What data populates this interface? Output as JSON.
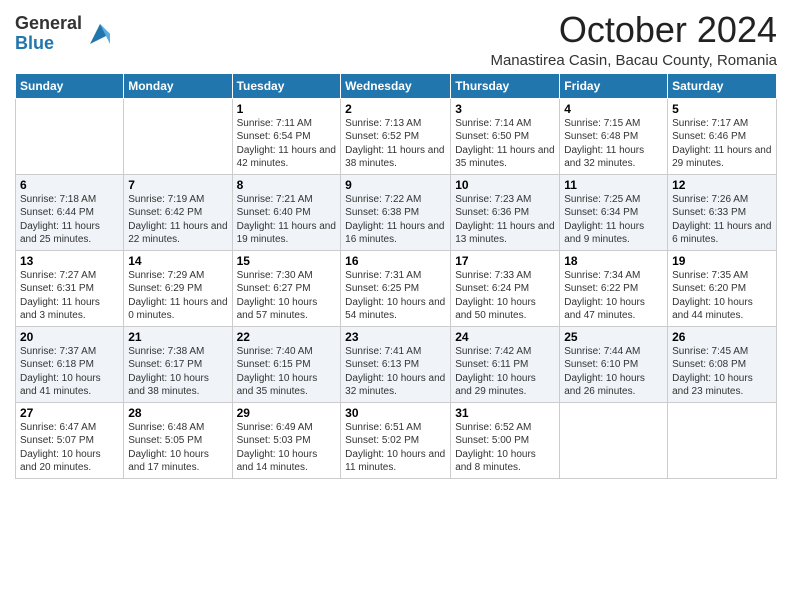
{
  "logo": {
    "general": "General",
    "blue": "Blue"
  },
  "title": "October 2024",
  "location": "Manastirea Casin, Bacau County, Romania",
  "days_of_week": [
    "Sunday",
    "Monday",
    "Tuesday",
    "Wednesday",
    "Thursday",
    "Friday",
    "Saturday"
  ],
  "weeks": [
    [
      {
        "day": "",
        "info": ""
      },
      {
        "day": "",
        "info": ""
      },
      {
        "day": "1",
        "info": "Sunrise: 7:11 AM\nSunset: 6:54 PM\nDaylight: 11 hours and 42 minutes."
      },
      {
        "day": "2",
        "info": "Sunrise: 7:13 AM\nSunset: 6:52 PM\nDaylight: 11 hours and 38 minutes."
      },
      {
        "day": "3",
        "info": "Sunrise: 7:14 AM\nSunset: 6:50 PM\nDaylight: 11 hours and 35 minutes."
      },
      {
        "day": "4",
        "info": "Sunrise: 7:15 AM\nSunset: 6:48 PM\nDaylight: 11 hours and 32 minutes."
      },
      {
        "day": "5",
        "info": "Sunrise: 7:17 AM\nSunset: 6:46 PM\nDaylight: 11 hours and 29 minutes."
      }
    ],
    [
      {
        "day": "6",
        "info": "Sunrise: 7:18 AM\nSunset: 6:44 PM\nDaylight: 11 hours and 25 minutes."
      },
      {
        "day": "7",
        "info": "Sunrise: 7:19 AM\nSunset: 6:42 PM\nDaylight: 11 hours and 22 minutes."
      },
      {
        "day": "8",
        "info": "Sunrise: 7:21 AM\nSunset: 6:40 PM\nDaylight: 11 hours and 19 minutes."
      },
      {
        "day": "9",
        "info": "Sunrise: 7:22 AM\nSunset: 6:38 PM\nDaylight: 11 hours and 16 minutes."
      },
      {
        "day": "10",
        "info": "Sunrise: 7:23 AM\nSunset: 6:36 PM\nDaylight: 11 hours and 13 minutes."
      },
      {
        "day": "11",
        "info": "Sunrise: 7:25 AM\nSunset: 6:34 PM\nDaylight: 11 hours and 9 minutes."
      },
      {
        "day": "12",
        "info": "Sunrise: 7:26 AM\nSunset: 6:33 PM\nDaylight: 11 hours and 6 minutes."
      }
    ],
    [
      {
        "day": "13",
        "info": "Sunrise: 7:27 AM\nSunset: 6:31 PM\nDaylight: 11 hours and 3 minutes."
      },
      {
        "day": "14",
        "info": "Sunrise: 7:29 AM\nSunset: 6:29 PM\nDaylight: 11 hours and 0 minutes."
      },
      {
        "day": "15",
        "info": "Sunrise: 7:30 AM\nSunset: 6:27 PM\nDaylight: 10 hours and 57 minutes."
      },
      {
        "day": "16",
        "info": "Sunrise: 7:31 AM\nSunset: 6:25 PM\nDaylight: 10 hours and 54 minutes."
      },
      {
        "day": "17",
        "info": "Sunrise: 7:33 AM\nSunset: 6:24 PM\nDaylight: 10 hours and 50 minutes."
      },
      {
        "day": "18",
        "info": "Sunrise: 7:34 AM\nSunset: 6:22 PM\nDaylight: 10 hours and 47 minutes."
      },
      {
        "day": "19",
        "info": "Sunrise: 7:35 AM\nSunset: 6:20 PM\nDaylight: 10 hours and 44 minutes."
      }
    ],
    [
      {
        "day": "20",
        "info": "Sunrise: 7:37 AM\nSunset: 6:18 PM\nDaylight: 10 hours and 41 minutes."
      },
      {
        "day": "21",
        "info": "Sunrise: 7:38 AM\nSunset: 6:17 PM\nDaylight: 10 hours and 38 minutes."
      },
      {
        "day": "22",
        "info": "Sunrise: 7:40 AM\nSunset: 6:15 PM\nDaylight: 10 hours and 35 minutes."
      },
      {
        "day": "23",
        "info": "Sunrise: 7:41 AM\nSunset: 6:13 PM\nDaylight: 10 hours and 32 minutes."
      },
      {
        "day": "24",
        "info": "Sunrise: 7:42 AM\nSunset: 6:11 PM\nDaylight: 10 hours and 29 minutes."
      },
      {
        "day": "25",
        "info": "Sunrise: 7:44 AM\nSunset: 6:10 PM\nDaylight: 10 hours and 26 minutes."
      },
      {
        "day": "26",
        "info": "Sunrise: 7:45 AM\nSunset: 6:08 PM\nDaylight: 10 hours and 23 minutes."
      }
    ],
    [
      {
        "day": "27",
        "info": "Sunrise: 6:47 AM\nSunset: 5:07 PM\nDaylight: 10 hours and 20 minutes."
      },
      {
        "day": "28",
        "info": "Sunrise: 6:48 AM\nSunset: 5:05 PM\nDaylight: 10 hours and 17 minutes."
      },
      {
        "day": "29",
        "info": "Sunrise: 6:49 AM\nSunset: 5:03 PM\nDaylight: 10 hours and 14 minutes."
      },
      {
        "day": "30",
        "info": "Sunrise: 6:51 AM\nSunset: 5:02 PM\nDaylight: 10 hours and 11 minutes."
      },
      {
        "day": "31",
        "info": "Sunrise: 6:52 AM\nSunset: 5:00 PM\nDaylight: 10 hours and 8 minutes."
      },
      {
        "day": "",
        "info": ""
      },
      {
        "day": "",
        "info": ""
      }
    ]
  ]
}
